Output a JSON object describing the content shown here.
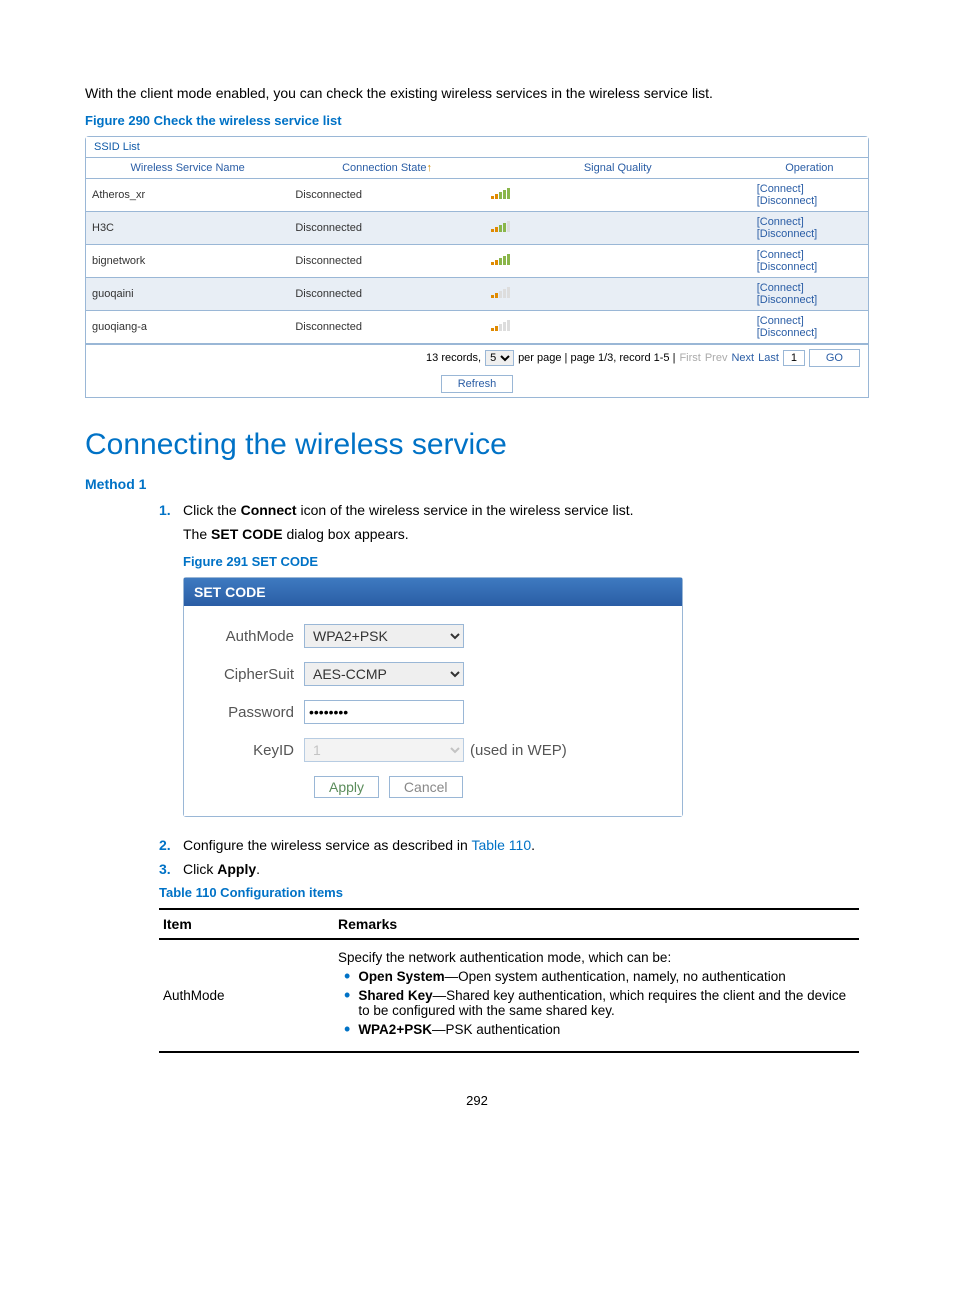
{
  "intro": "With the client mode enabled, you can check the existing wireless services in the wireless service list.",
  "figure290": "Figure 290 Check the wireless service list",
  "ssid": {
    "panelTitle": "SSID List",
    "headers": [
      "Wireless Service Name",
      "Connection State",
      "Signal Quality",
      "Operation"
    ],
    "rows": [
      {
        "name": "Atheros_xr",
        "state": "Disconnected",
        "signal": 5
      },
      {
        "name": "H3C",
        "state": "Disconnected",
        "signal": 4
      },
      {
        "name": "bignetwork",
        "state": "Disconnected",
        "signal": 5
      },
      {
        "name": "guoqaini",
        "state": "Disconnected",
        "signal": 2
      },
      {
        "name": "guoqiang-a",
        "state": "Disconnected",
        "signal": 2
      }
    ],
    "op": {
      "connect": "[Connect]",
      "disconnect": "[Disconnect]"
    },
    "pager": {
      "records": "13 records,",
      "perPageValue": "5",
      "perPageLabel": "per page | page 1/3, record 1-5 |",
      "nav": [
        "First",
        "Prev",
        "Next",
        "Last"
      ],
      "pageInput": "1",
      "go": "GO"
    },
    "refresh": "Refresh"
  },
  "h1": "Connecting the wireless service",
  "method1": "Method 1",
  "steps": {
    "s1_num": "1.",
    "s1_text_a": "Click the ",
    "s1_connect": "Connect",
    "s1_text_b": " icon of the wireless service in the wireless service list.",
    "s1_sub_a": "The ",
    "s1_sub_bold": "SET CODE",
    "s1_sub_b": " dialog box appears.",
    "s2_num": "2.",
    "s2_text": "Configure the wireless service as described in ",
    "s2_link": "Table 110",
    "s2_end": ".",
    "s3_num": "3.",
    "s3_text": "Click ",
    "s3_bold": "Apply",
    "s3_end": "."
  },
  "figure291": "Figure 291 SET CODE",
  "setcode": {
    "title": "SET CODE",
    "labels": {
      "authmode": "AuthMode",
      "ciphersuit": "CipherSuit",
      "password": "Password",
      "keyid": "KeyID"
    },
    "values": {
      "authmode": "WPA2+PSK",
      "ciphersuit": "AES-CCMP",
      "password": "••••••••",
      "keyid": "1"
    },
    "note": "(used in WEP)",
    "apply": "Apply",
    "cancel": "Cancel"
  },
  "table110caption": "Table 110 Configuration items",
  "config": {
    "th1": "Item",
    "th2": "Remarks",
    "item": "AuthMode",
    "remarks_intro": "Specify the network authentication mode, which can be:",
    "b1_bold": "Open System",
    "b1_rest": "—Open system authentication, namely, no authentication",
    "b2_bold": "Shared Key",
    "b2_rest": "—Shared key authentication, which requires the client and the device to be configured with the same shared key.",
    "b3_bold": "WPA2+PSK",
    "b3_rest": "—PSK authentication"
  },
  "pageNumber": "292"
}
